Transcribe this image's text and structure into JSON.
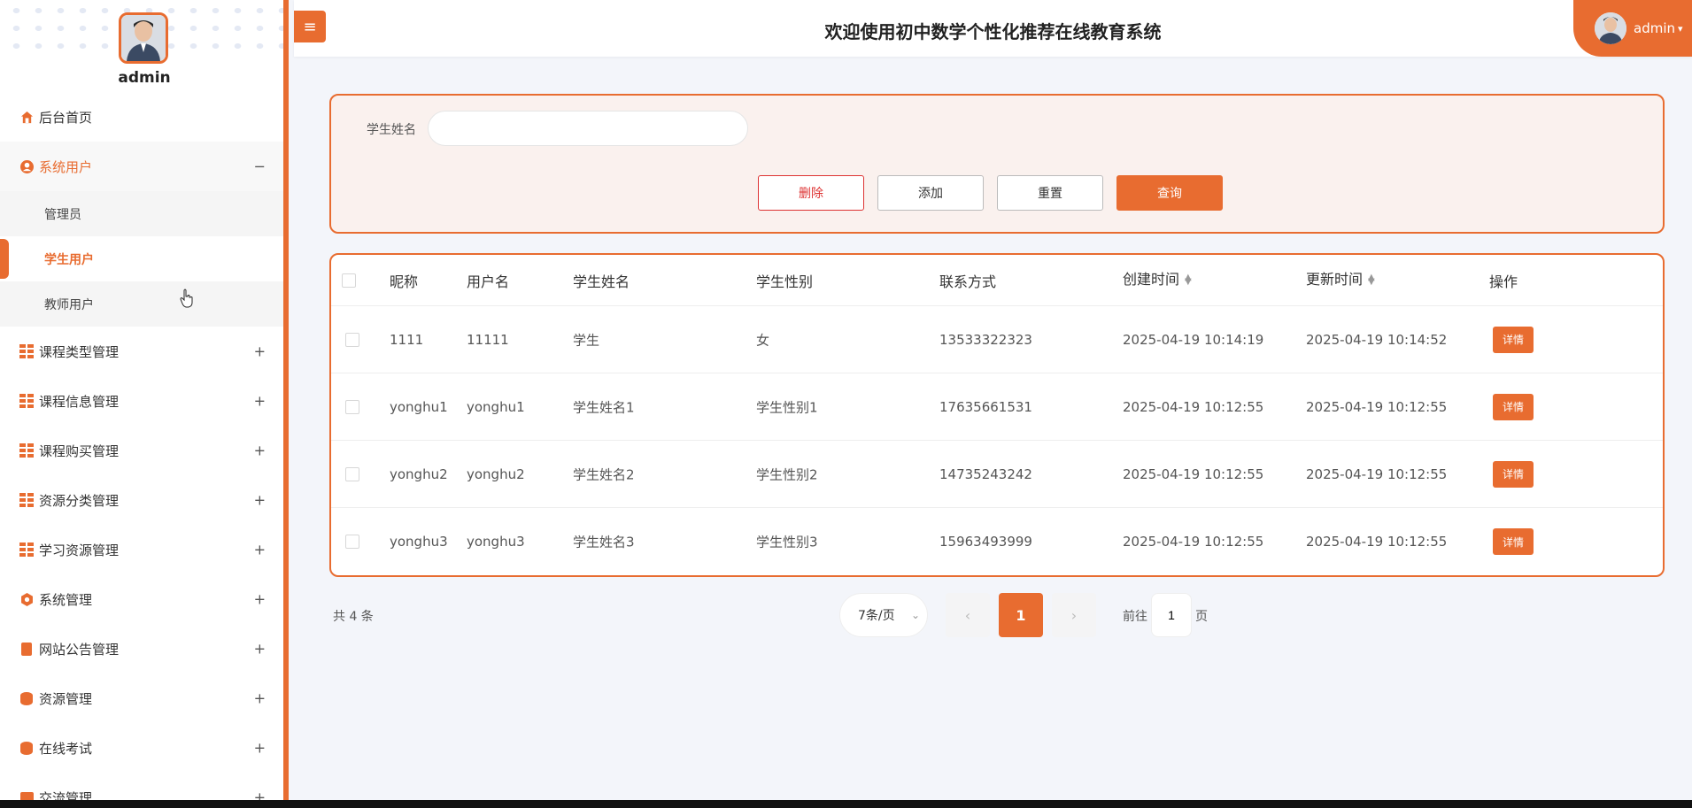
{
  "sidebar": {
    "username": "admin",
    "menu": [
      {
        "label": "后台首页",
        "icon": "home-icon"
      },
      {
        "label": "系统用户",
        "icon": "user-circle-icon",
        "expanded": true,
        "children": [
          "管理员",
          "学生用户",
          "教师用户"
        ],
        "current": "学生用户"
      },
      {
        "label": "课程类型管理",
        "icon": "grid-icon"
      },
      {
        "label": "课程信息管理",
        "icon": "grid-icon"
      },
      {
        "label": "课程购买管理",
        "icon": "grid-icon"
      },
      {
        "label": "资源分类管理",
        "icon": "grid-icon"
      },
      {
        "label": "学习资源管理",
        "icon": "grid-icon"
      },
      {
        "label": "系统管理",
        "icon": "gear-icon"
      },
      {
        "label": "网站公告管理",
        "icon": "document-icon"
      },
      {
        "label": "资源管理",
        "icon": "database-icon"
      },
      {
        "label": "在线考试",
        "icon": "database-icon"
      },
      {
        "label": "交流管理",
        "icon": "chat-icon"
      }
    ],
    "collapse_symbol": "−",
    "expand_symbol": "+"
  },
  "header": {
    "menu_toggle": "≡",
    "title": "欢迎使用初中数学个性化推荐在线教育系统",
    "user": "admin"
  },
  "search": {
    "label": "学生姓名",
    "value": "",
    "placeholder": ""
  },
  "buttons": {
    "delete": "删除",
    "add": "添加",
    "reset": "重置",
    "query": "查询"
  },
  "table": {
    "headers": [
      "昵称",
      "用户名",
      "学生姓名",
      "学生性别",
      "联系方式",
      "创建时间",
      "更新时间",
      "操作"
    ],
    "rows": [
      [
        "1111",
        "11111",
        "学生",
        "女",
        "13533322323",
        "2025-04-19 10:14:19",
        "2025-04-19 10:14:52"
      ],
      [
        "yonghu1",
        "yonghu1",
        "学生姓名1",
        "学生性别1",
        "17635661531",
        "2025-04-19 10:12:55",
        "2025-04-19 10:12:55"
      ],
      [
        "yonghu2",
        "yonghu2",
        "学生姓名2",
        "学生性别2",
        "14735243242",
        "2025-04-19 10:12:55",
        "2025-04-19 10:12:55"
      ],
      [
        "yonghu3",
        "yonghu3",
        "学生姓名3",
        "学生性别3",
        "15963493999",
        "2025-04-19 10:12:55",
        "2025-04-19 10:12:55"
      ]
    ],
    "action_label": "详情"
  },
  "pagination": {
    "total": "共 4 条",
    "page_size": "7条/页",
    "current_page": "1",
    "goto_prefix": "前往",
    "goto_value": "1",
    "goto_suffix": "页",
    "prev": "‹",
    "next": "›"
  },
  "colors": {
    "accent": "#e86c30",
    "danger": "#dd3333",
    "background": "#f3f5fa"
  }
}
